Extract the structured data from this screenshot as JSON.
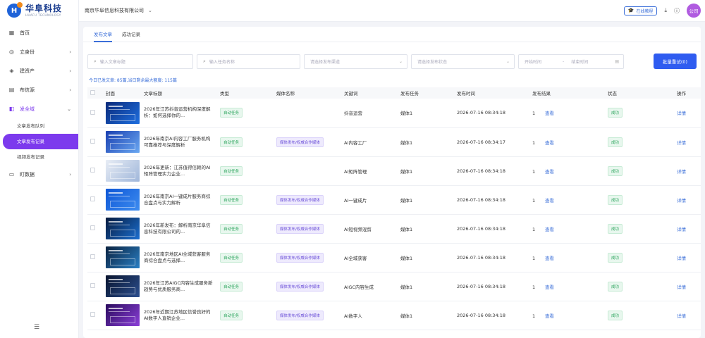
{
  "brand": {
    "name": "华阜科技",
    "sub": "HUAFU TECHNOLOGY",
    "mark": "H"
  },
  "header": {
    "company": "南京华阜信息科技有限公司",
    "tutorial": "在线教程",
    "avatar": "公司"
  },
  "sidebar": {
    "items": [
      {
        "label": "首页",
        "icon": "grid-icon",
        "glyph": "▦"
      },
      {
        "label": "立身份",
        "icon": "identity-icon",
        "glyph": "◎"
      },
      {
        "label": "建资产",
        "icon": "asset-icon",
        "glyph": "◈"
      },
      {
        "label": "布信源",
        "icon": "source-icon",
        "glyph": "▤"
      },
      {
        "label": "发全域",
        "icon": "publish-icon",
        "glyph": "◧"
      },
      {
        "label": "盯数据",
        "icon": "data-icon",
        "glyph": "▭"
      }
    ],
    "sub_items": [
      "文章发布队列",
      "文章发布记录",
      "视频发布记录"
    ]
  },
  "tabs": [
    "发布文章",
    "成功记录"
  ],
  "filters": {
    "title_placeholder": "输入文章标题",
    "task_placeholder": "输入任务名称",
    "channel_placeholder": "请选择发布渠道",
    "status_placeholder": "请选择发布状态",
    "start_placeholder": "开始时间",
    "end_placeholder": "结束时间",
    "range_sep": "-",
    "batch_button": "批量重试(0)"
  },
  "stats": "今日已发文章: 85篇,当日剩余最大额度: 115篇",
  "columns": [
    "封面",
    "文章标题",
    "类型",
    "媒体名称",
    "关键词",
    "发布任务",
    "发布时间",
    "发布结果",
    "状态",
    "操作"
  ],
  "rows": [
    {
      "title": "2026年江苏抖音运营机构深度解析：如何选择你的...",
      "type": "自动任务",
      "media": "",
      "keyword": "抖音运营",
      "task": "媒体1",
      "time": "2026-07-16 08:34:18",
      "count": "1",
      "result": "查看",
      "status": "成功",
      "op": "详情",
      "thumb": [
        "#0b2a7a",
        "#1e6fe0"
      ]
    },
    {
      "title": "2026年南京AI内容工厂服务机构可靠推荐与深度解析",
      "type": "自动任务",
      "media": "媒体发布/权威合作媒体",
      "keyword": "AI内容工厂",
      "task": "媒体1",
      "time": "2026-07-16 08:34:17",
      "count": "1",
      "result": "查看",
      "status": "成功",
      "op": "详情",
      "thumb": [
        "#1a3fb0",
        "#6aa8f2"
      ]
    },
    {
      "title": "2026年更新：江苏值得信赖的AI矩阵管理实力企业...",
      "type": "自动任务",
      "media": "",
      "keyword": "AI矩阵管理",
      "task": "媒体1",
      "time": "2026-07-16 08:34:18",
      "count": "1",
      "result": "查看",
      "status": "成功",
      "op": "详情",
      "thumb": [
        "#e8edf5",
        "#9fb6da"
      ]
    },
    {
      "title": "2026年南京AI一键成片服务商综合盘点与实力解析",
      "type": "自动任务",
      "media": "媒体发布/权威合作媒体",
      "keyword": "AI一键成片",
      "task": "媒体1",
      "time": "2026-07-16 08:34:18",
      "count": "1",
      "result": "查看",
      "status": "成功",
      "op": "详情",
      "thumb": [
        "#0d56d6",
        "#3d8cf0"
      ]
    },
    {
      "title": "2026年新发布：解析南京华阜信息科技有限公司的...",
      "type": "自动任务",
      "media": "媒体发布/权威合作媒体",
      "keyword": "AI短视频混剪",
      "task": "媒体1",
      "time": "2026-07-16 08:34:18",
      "count": "1",
      "result": "查看",
      "status": "成功",
      "op": "详情",
      "thumb": [
        "#061a3d",
        "#1b6fd1"
      ]
    },
    {
      "title": "2026年南京地区AI全域获客服务商综合盘点与选择...",
      "type": "自动任务",
      "media": "媒体发布/权威合作媒体",
      "keyword": "AI全域获客",
      "task": "媒体1",
      "time": "2026-07-16 08:34:18",
      "count": "1",
      "result": "查看",
      "status": "成功",
      "op": "详情",
      "thumb": [
        "#0a2240",
        "#2a7fc4"
      ]
    },
    {
      "title": "2026年江苏AIGC内容生成服务新趋势与优质服务商...",
      "type": "自动任务",
      "media": "媒体发布/权威合作媒体",
      "keyword": "AIGC内容生成",
      "task": "媒体1",
      "time": "2026-07-16 08:34:18",
      "count": "1",
      "result": "查看",
      "status": "成功",
      "op": "详情",
      "thumb": [
        "#08142e",
        "#2c4f8f"
      ]
    },
    {
      "title": "2026年近期江苏地区信誉良好的AI数字人直销企业...",
      "type": "自动任务",
      "media": "媒体发布/权威合作媒体",
      "keyword": "AI数字人",
      "task": "媒体1",
      "time": "2026-07-16 08:34:18",
      "count": "1",
      "result": "查看",
      "status": "成功",
      "op": "详情",
      "thumb": [
        "#2a0b5e",
        "#8b3fd8"
      ]
    }
  ]
}
